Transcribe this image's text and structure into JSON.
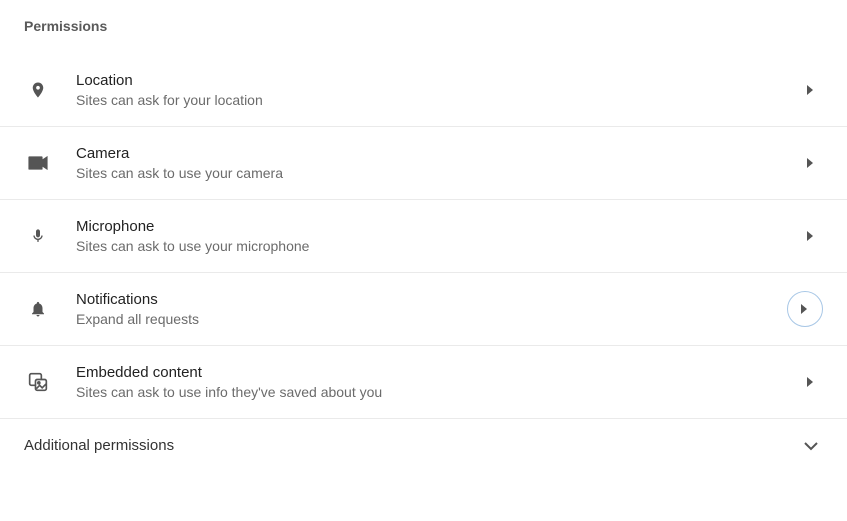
{
  "section_header": "Permissions",
  "permissions": {
    "location": {
      "title": "Location",
      "desc": "Sites can ask for your location"
    },
    "camera": {
      "title": "Camera",
      "desc": "Sites can ask to use your camera"
    },
    "microphone": {
      "title": "Microphone",
      "desc": "Sites can ask to use your microphone"
    },
    "notifications": {
      "title": "Notifications",
      "desc": "Expand all requests"
    },
    "embedded": {
      "title": "Embedded content",
      "desc": "Sites can ask to use info they've saved about you"
    }
  },
  "additional_label": "Additional permissions"
}
